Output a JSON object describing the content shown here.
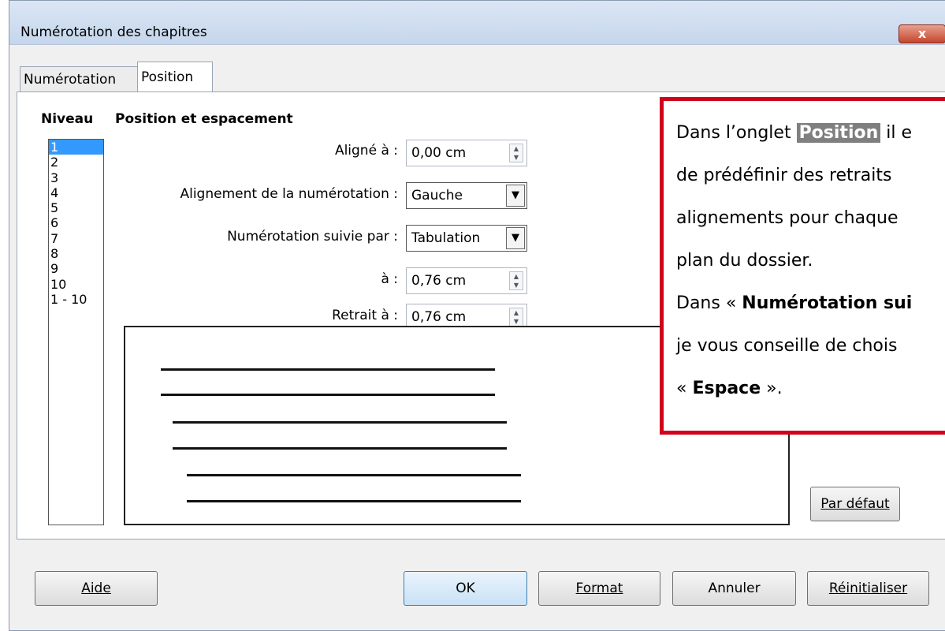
{
  "window": {
    "title": "Numérotation des chapitres",
    "close": "x"
  },
  "tabs": [
    {
      "label": "Numérotation"
    },
    {
      "label": "Position"
    }
  ],
  "section": {
    "niveau": "Niveau",
    "position": "Position et espacement"
  },
  "levels": [
    "1",
    "2",
    "3",
    "4",
    "5",
    "6",
    "7",
    "8",
    "9",
    "10",
    "1 - 10"
  ],
  "fields": {
    "aligne_label": "Aligné à :",
    "aligne_value": "0,00 cm",
    "alignement_label": "Alignement de la numérotation :",
    "alignement_value": "Gauche",
    "suivie_label": "Numérotation suivie par :",
    "suivie_value": "Tabulation",
    "a_label": "à :",
    "a_value": "0,76 cm",
    "retrait_label": "Retrait à :",
    "retrait_value": "0,76 cm"
  },
  "buttons": {
    "par_defaut": "Par défaut",
    "aide": "Aide",
    "ok": "OK",
    "format": "Format",
    "annuler": "Annuler",
    "reinitialiser": "Réinitialiser"
  },
  "callout": {
    "l1a": "Dans l’onglet ",
    "l1b": "Position",
    "l1c": " il e",
    "l2": "de prédéfinir des retraits",
    "l3": "alignements pour chaque",
    "l4": "plan du dossier.",
    "l5a": "Dans « ",
    "l5b": "Numérotation sui",
    "l6": "je vous conseille de chois",
    "l7a": "« ",
    "l7b": "Espace",
    "l7c": " »."
  }
}
